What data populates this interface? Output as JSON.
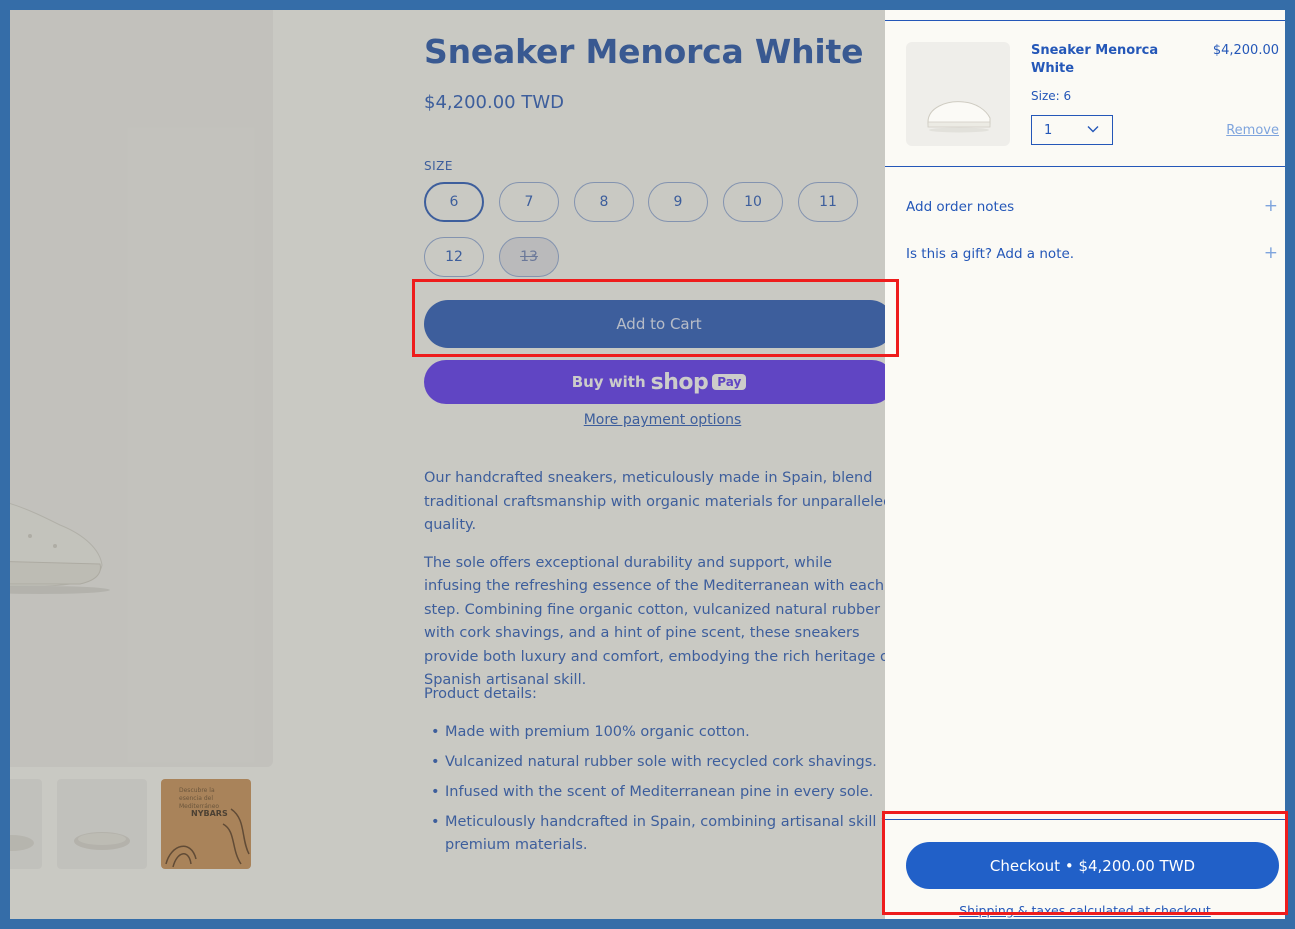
{
  "product": {
    "title": "Sneaker Menorca White",
    "price": "$4,200.00 TWD",
    "size_label": "SIZE",
    "sizes": [
      {
        "label": "6",
        "selected": true,
        "available": true
      },
      {
        "label": "7",
        "selected": false,
        "available": true
      },
      {
        "label": "8",
        "selected": false,
        "available": true
      },
      {
        "label": "9",
        "selected": false,
        "available": true
      },
      {
        "label": "10",
        "selected": false,
        "available": true
      },
      {
        "label": "11",
        "selected": false,
        "available": true
      },
      {
        "label": "12",
        "selected": false,
        "available": true
      },
      {
        "label": "13",
        "selected": false,
        "available": false
      }
    ],
    "add_to_cart_label": "Add to Cart",
    "shop_pay": {
      "prefix": "Buy with",
      "brand": "shop",
      "badge": "Pay"
    },
    "more_payment_label": "More payment options",
    "description": [
      "Our handcrafted sneakers, meticulously made in Spain, blend traditional craftsmanship with organic materials for unparalleled quality.",
      "The sole offers exceptional durability and support, while infusing the refreshing essence of the Mediterranean with each step. Combining fine organic cotton, vulcanized natural rubber with cork shavings, and a hint of pine scent, these sneakers provide both luxury and comfort, embodying the rich heritage of Spanish artisanal skill."
    ],
    "details_heading": "Product details:",
    "details": [
      "Made with premium 100% organic cotton.",
      "Vulcanized natural rubber sole with recycled cork shavings.",
      "Infused with the scent of Mediterranean pine in every sole.",
      "Meticulously handcrafted in Spain, combining artisanal skill with premium materials."
    ],
    "thumbnail_box": {
      "text": "Descubre la esencia del Mediterráneo",
      "logo": "NYBARS"
    }
  },
  "cart": {
    "item": {
      "name": "Sneaker Menorca White",
      "price": "$4,200.00",
      "size": "Size: 6",
      "quantity": "1",
      "remove_label": "Remove"
    },
    "order_notes_label": "Add order notes",
    "gift_note_label": "Is this a gift? Add a note.",
    "plus_glyph": "+",
    "checkout_label": "Checkout • $4,200.00 TWD",
    "shipping_note": "Shipping & taxes calculated at checkout"
  },
  "colors": {
    "brand_blue": "#2457b8",
    "checkout_blue": "#2160c8",
    "shop_pay_purple": "#5a31f4",
    "highlight_red": "#ee1c1c",
    "frame_blue": "#356da8"
  }
}
